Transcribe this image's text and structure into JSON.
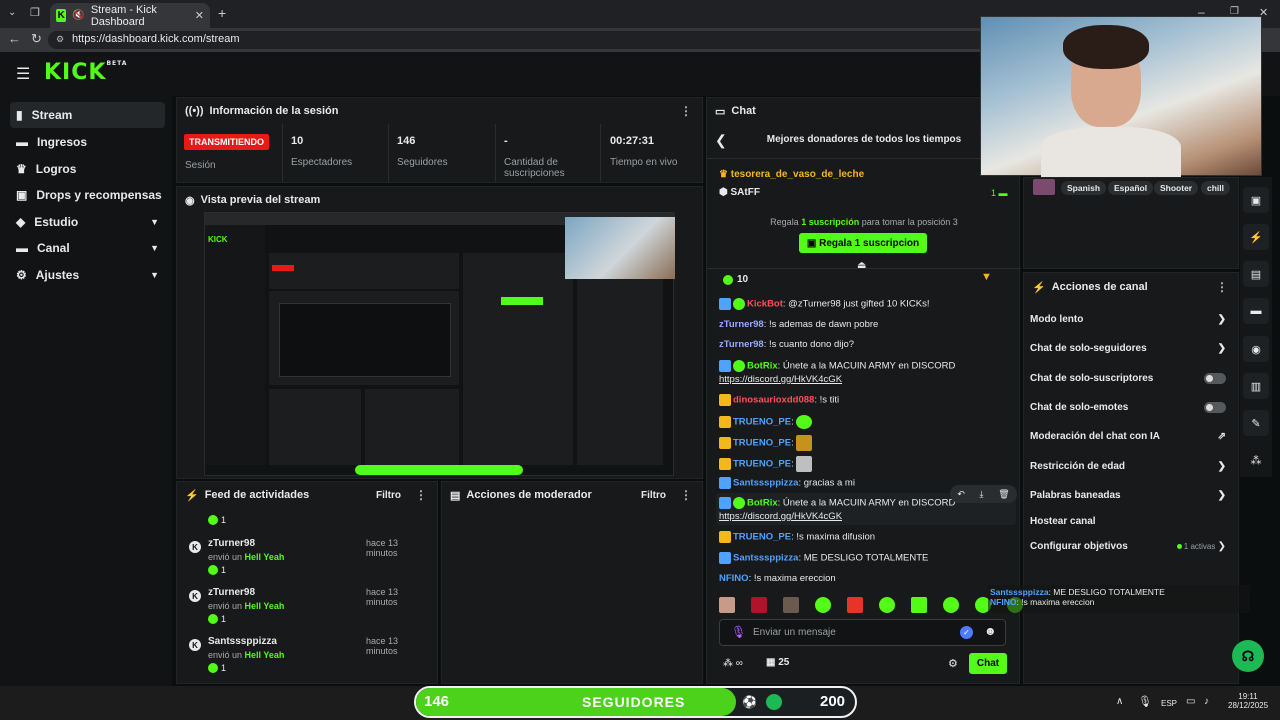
{
  "browser": {
    "tab_title": "Stream - Kick Dashboard",
    "url": "https://dashboard.kick.com/stream"
  },
  "app": {
    "logo": "KICK",
    "logo_sup": "BETA"
  },
  "sidebar": {
    "items": [
      {
        "label": "Stream",
        "icon": "stream-icon"
      },
      {
        "label": "Ingresos",
        "icon": "money-icon"
      },
      {
        "label": "Logros",
        "icon": "trophy-icon"
      },
      {
        "label": "Drops y recompensas",
        "icon": "gift-icon"
      },
      {
        "label": "Estudio",
        "icon": "studio-icon"
      },
      {
        "label": "Canal",
        "icon": "channel-icon"
      },
      {
        "label": "Ajustes",
        "icon": "gear-icon"
      }
    ]
  },
  "session": {
    "title": "Información de la sesión",
    "status": "TRANSMITIENDO",
    "status_label": "Sesión",
    "viewers_val": "10",
    "viewers_label": "Espectadores",
    "followers_val": "146",
    "followers_label": "Seguidores",
    "subs_val": "-",
    "subs_label": "Cantidad de suscripciones",
    "time_val": "00:27:31",
    "time_label": "Tiempo en vivo"
  },
  "preview": {
    "title": "Vista previa del stream"
  },
  "feed": {
    "title": "Feed de actividades",
    "filter": "Filtro",
    "top_count": "1",
    "rows": [
      {
        "user": "zTurner98",
        "time": "hace 13 minutos",
        "action": "envió un",
        "item": "Hell Yeah",
        "count": "1"
      },
      {
        "user": "zTurner98",
        "time": "hace 13 minutos",
        "action": "envió un",
        "item": "Hell Yeah",
        "count": "1"
      },
      {
        "user": "Santsssppizza",
        "time": "hace 13 minutos",
        "action": "envió un",
        "item": "Hell Yeah",
        "count": "1"
      }
    ]
  },
  "moderator": {
    "title": "Acciones de moderador",
    "filter": "Filtro"
  },
  "chat": {
    "title": "Chat",
    "donors_title": "Mejores donadores de todos los tiempos",
    "donor1": "tesorera_de_vaso_de_leche",
    "donor2": "SAtFF",
    "donor2_count": "1",
    "gift_text_pre": "Regala",
    "gift_text_sub": "1 suscripción",
    "gift_text_post": "para tomar la posición 3",
    "gift_button": "Regala 1 suscripcion",
    "count_row": "10",
    "messages": [
      {
        "user": "KickBot",
        "text": ": @zTurner98 just gifted 10 KICKs!",
        "color": "#ff4f5e"
      },
      {
        "user": "zTurner98",
        "text": ": !s ademas de dawn pobre",
        "color": "#9aa9ff"
      },
      {
        "user": "zTurner98",
        "text": ": !s cuanto dono dijo?",
        "color": "#9aa9ff"
      },
      {
        "user": "BotRix",
        "text": ": Únete a la MACUIN ARMY en DISCORD",
        "color": "#53fc18"
      },
      {
        "user": "",
        "text": "https://discord.gg/HkVK4cGK",
        "color": "#e8eaea"
      },
      {
        "user": "dinosaurioxdd088",
        "text": ": !s titi",
        "color": "#ff4f5e"
      },
      {
        "user": "TRUENO_PE",
        "text": ":",
        "color": "#4fa3ff"
      },
      {
        "user": "TRUENO_PE",
        "text": ":",
        "color": "#4fa3ff"
      },
      {
        "user": "TRUENO_PE",
        "text": ":",
        "color": "#4fa3ff"
      },
      {
        "user": "Santsssppizza",
        "text": ": gracias a mi",
        "color": "#4fa3ff"
      },
      {
        "user": "BotRix",
        "text": ": Únete a la MACUIN ARMY en DISCORD",
        "color": "#53fc18"
      },
      {
        "user": "",
        "text": "https://discord.gg/HkVK4cGK",
        "color": "#e8eaea"
      },
      {
        "user": "TRUENO_PE",
        "text": ": !s maxima difusion",
        "color": "#4fa3ff"
      },
      {
        "user": "Santsssppizza",
        "text": ": ME DESLIGO TOTALMENTE",
        "color": "#4fa3ff"
      },
      {
        "user": "NFINO",
        "text": ": !s maxima ereccion",
        "color": "#4fa3ff"
      }
    ],
    "input_placeholder": "Enviar un mensaje",
    "viewers_count": "25",
    "send_button": "Chat"
  },
  "overlay_chat": [
    {
      "user": "Santsssppizza",
      "text": ": ME DESLIGO TOTALMENTE"
    },
    {
      "user": "NFINO",
      "text": ": !s maxima ereccion"
    }
  ],
  "tags": [
    "Spanish",
    "Español",
    "Shooter",
    "chill"
  ],
  "actions": {
    "title": "Acciones de canal",
    "rows": [
      {
        "label": "Modo lento"
      },
      {
        "label": "Chat de solo-seguidores"
      },
      {
        "label": "Chat de solo-suscriptores"
      },
      {
        "label": "Chat de solo-emotes"
      },
      {
        "label": "Moderación del chat con IA"
      },
      {
        "label": "Restricción de edad"
      },
      {
        "label": "Palabras baneadas"
      },
      {
        "label": "Hostear canal"
      },
      {
        "label": "Configurar objetivos"
      }
    ],
    "goals_status": "1 activas"
  },
  "goal_bar": {
    "current": "146",
    "label": "SEGUIDORES",
    "target": "200",
    "progress": 0.73
  },
  "taskbar": {
    "lang": "ESP",
    "time": "19:11",
    "date": "28/12/2025"
  },
  "colors": {
    "accent": "#53fc18",
    "live": "#e91916",
    "panel": "#17191b"
  }
}
